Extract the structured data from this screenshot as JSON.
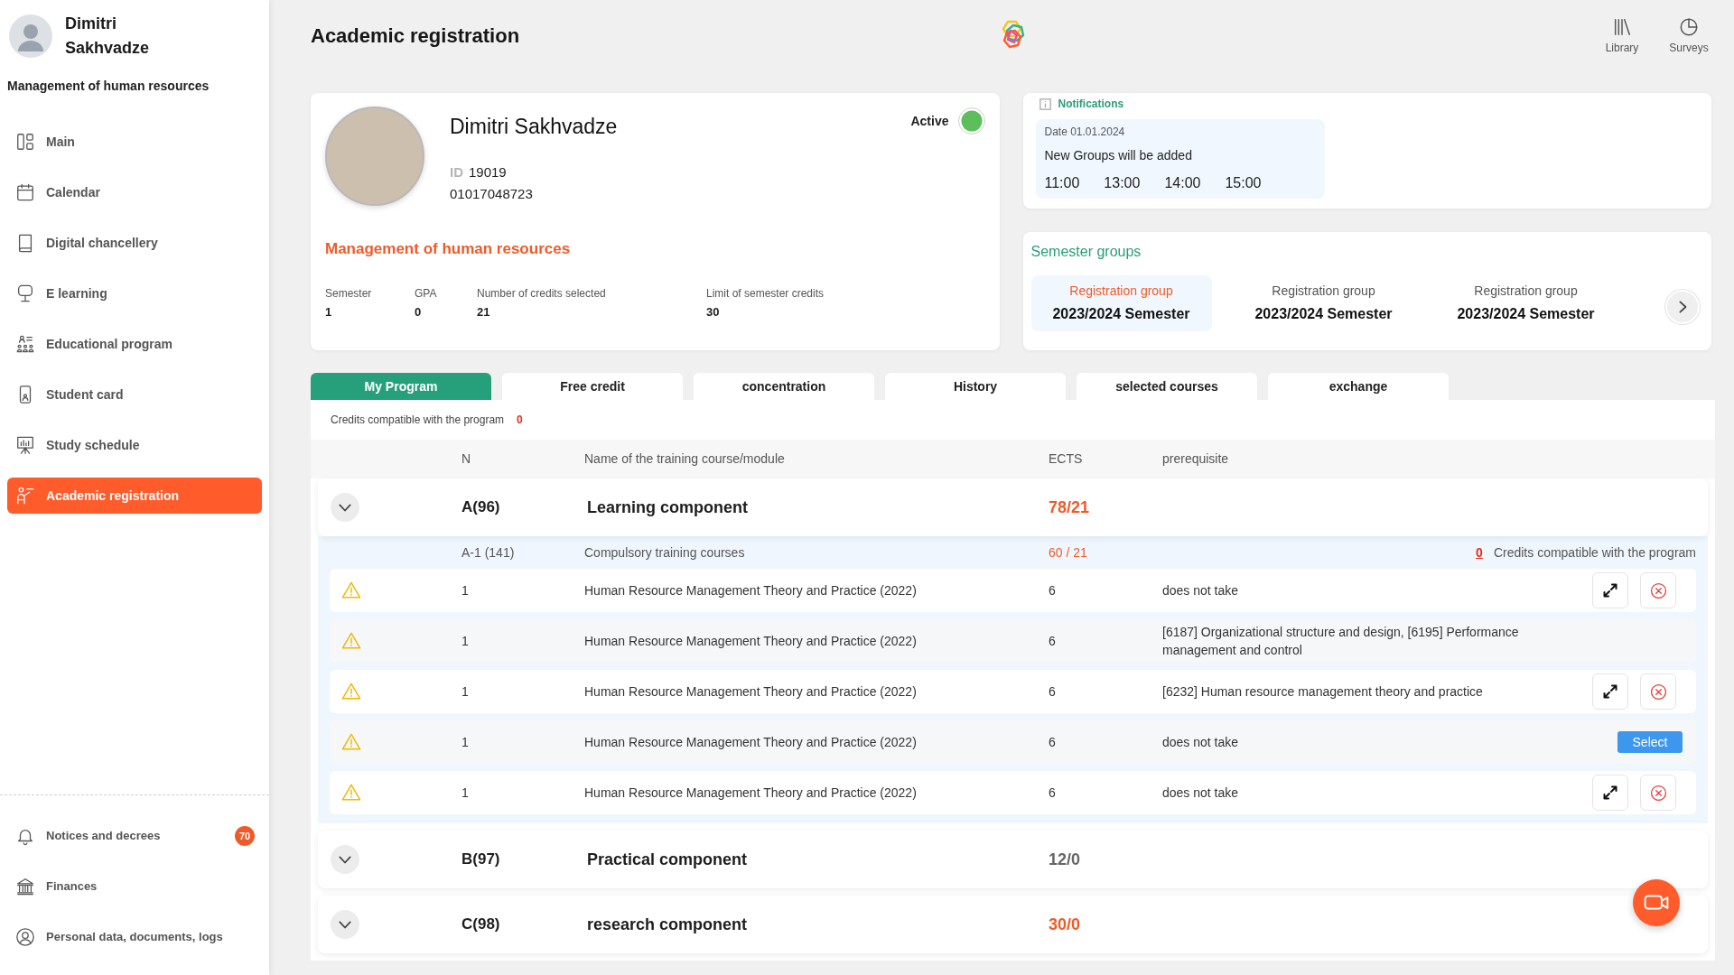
{
  "sidebar": {
    "user_name": "Dimitri Sakhvadze",
    "department": "Management of human resources",
    "items": [
      {
        "label": "Main",
        "selected": false
      },
      {
        "label": "Calendar",
        "selected": false
      },
      {
        "label": "Digital chancellery",
        "selected": false
      },
      {
        "label": "E learning",
        "selected": false
      },
      {
        "label": "Educational program",
        "selected": false
      },
      {
        "label": "Student card",
        "selected": false
      },
      {
        "label": "Study schedule",
        "selected": false
      },
      {
        "label": "Academic registration",
        "selected": true
      }
    ],
    "bottom_items": [
      {
        "label": "Notices and decrees",
        "badge": "70",
        "selected": false
      },
      {
        "label": "Finances",
        "selected": false
      },
      {
        "label": "Personal data, documents, logs",
        "selected": false
      }
    ]
  },
  "header": {
    "title": "Academic registration",
    "shortcuts": [
      {
        "label": "Library"
      },
      {
        "label": "Surveys"
      }
    ]
  },
  "profile": {
    "name": "Dimitri Sakhvadze",
    "id_label": "ID",
    "id": "19019",
    "personal_number": "01017048723",
    "status": {
      "label": "Active",
      "active": true
    },
    "program": "Management of human resources",
    "stats": [
      {
        "label": "Semester",
        "value": "1"
      },
      {
        "label": "GPA",
        "value": "0"
      },
      {
        "label": "Number of credits selected",
        "value": "21"
      },
      {
        "label": "Limit of semester credits",
        "value": "30"
      }
    ]
  },
  "notifications": {
    "title": "Notifications",
    "items": [
      {
        "date": "Date 01.01.2024",
        "message": "New Groups will be added",
        "times": [
          "11:00",
          "13:00",
          "14:00",
          "15:00"
        ]
      }
    ]
  },
  "semester_groups": {
    "title": "Semester groups",
    "groups": [
      {
        "label": "Registration group",
        "semester": "2023/2024 Semester",
        "selected": true
      },
      {
        "label": "Registration group",
        "semester": "2023/2024 Semester",
        "selected": false
      },
      {
        "label": "Registration group",
        "semester": "2023/2024 Semester",
        "selected": false
      }
    ]
  },
  "tabs": [
    {
      "label": "My Program",
      "selected": true
    },
    {
      "label": "Free credit",
      "selected": false
    },
    {
      "label": "concentration",
      "selected": false
    },
    {
      "label": "History",
      "selected": false
    },
    {
      "label": "selected courses",
      "selected": false
    },
    {
      "label": "exchange",
      "selected": false
    }
  ],
  "program": {
    "credits_label": "Credits compatible with the program",
    "credits_count": "0",
    "columns": [
      "N",
      "Name of the training course/module",
      "ECTS",
      "prerequisite"
    ],
    "groups": [
      {
        "code": "A(96)",
        "title": "Learning component",
        "ects": "78/21",
        "ects_highlight": true,
        "subgroups": [
          {
            "code": "A-1 (141)",
            "title": "Compulsory training courses",
            "ects": "60 / 21",
            "credits_count": "0",
            "credits_label": "Credits compatible with the program",
            "courses": [
              {
                "n": "1",
                "name": "Human Resource Management Theory and Practice (2022)",
                "ects": "6",
                "prerequisite": "does not take",
                "selected": true
              },
              {
                "n": "1",
                "name": "Human Resource Management Theory and Practice (2022)",
                "ects": "6",
                "prerequisite": "[6187] Organizational structure and design, [6195] Performance management and control",
                "selected": false
              },
              {
                "n": "1",
                "name": "Human Resource Management Theory and Practice (2022)",
                "ects": "6",
                "prerequisite": "[6232] Human resource management theory and practice",
                "selected": true
              },
              {
                "n": "1",
                "name": "Human Resource Management Theory and Practice (2022)",
                "ects": "6",
                "prerequisite": "does not take",
                "selected": false,
                "select_label": "Select"
              },
              {
                "n": "1",
                "name": "Human Resource Management Theory and Practice (2022)",
                "ects": "6",
                "prerequisite": "does not take",
                "selected": true
              }
            ]
          }
        ]
      },
      {
        "code": "B(97)",
        "title": "Practical component",
        "ects": "12/0",
        "ects_highlight": false
      },
      {
        "code": "C(98)",
        "title": "research component",
        "ects": "30/0",
        "ects_highlight": true
      }
    ]
  }
}
